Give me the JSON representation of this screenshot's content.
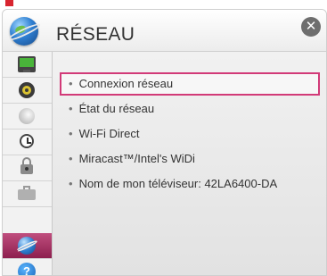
{
  "header": {
    "title": "RÉSEAU",
    "close_glyph": "✕"
  },
  "sidebar": {
    "items": [
      {
        "icon": "monitor-icon"
      },
      {
        "icon": "speaker-icon"
      },
      {
        "icon": "satellite-dish-icon"
      },
      {
        "icon": "clock-icon"
      },
      {
        "icon": "lock-icon"
      },
      {
        "icon": "briefcase-icon"
      },
      {
        "icon": "network-globe-icon",
        "active": true
      },
      {
        "icon": "help-icon",
        "glyph": "?"
      }
    ]
  },
  "menu": {
    "items": [
      {
        "label": "Connexion réseau",
        "selected": true
      },
      {
        "label": "État du réseau"
      },
      {
        "label": "Wi-Fi Direct"
      },
      {
        "label": "Miracast™/Intel's WiDi"
      },
      {
        "label": "Nom de mon téléviseur: 42LA6400-DA"
      }
    ]
  },
  "colors": {
    "highlight_border": "#d23a78",
    "active_tab": "#a83363",
    "top_marker": "#d8252f"
  }
}
